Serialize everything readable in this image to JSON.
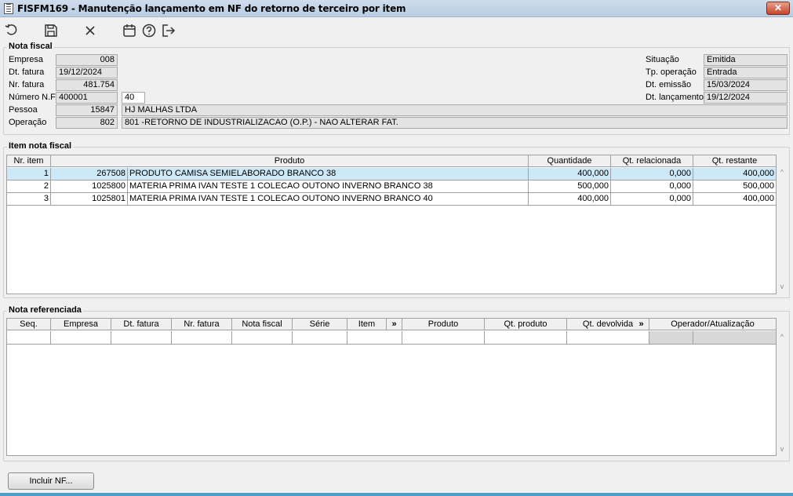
{
  "window": {
    "title": "FISFM169 - Manutenção lançamento em NF do retorno de terceiro por item",
    "close_glyph": "✕"
  },
  "toolbar": {
    "icons": [
      "undo-icon",
      "save-icon",
      "cancel-icon",
      "calendar-icon",
      "help-icon",
      "exit-icon"
    ]
  },
  "nota_fiscal": {
    "legend": "Nota fiscal",
    "empresa_label": "Empresa",
    "empresa": "008",
    "dt_fatura_label": "Dt. fatura",
    "dt_fatura": "19/12/2024",
    "nr_fatura_label": "Nr. fatura",
    "nr_fatura": "481.754",
    "numero_nf_label": "Número N.F",
    "numero_nf": "400001",
    "serie": "40",
    "pessoa_label": "Pessoa",
    "pessoa_code": "15847",
    "pessoa_name": "HJ MALHAS LTDA",
    "operacao_label": "Operação",
    "operacao_code": "802",
    "operacao_desc": "801 -RETORNO DE INDUSTRIALIZACAO (O.P.) - NAO ALTERAR FAT.",
    "situacao_label": "Situação",
    "situacao": "Emitida",
    "tp_operacao_label": "Tp. operação",
    "tp_operacao": "Entrada",
    "dt_emissao_label": "Dt. emissão",
    "dt_emissao": "15/03/2024",
    "dt_lancamento_label": "Dt. lançamento",
    "dt_lancamento": "19/12/2024"
  },
  "item_nota_fiscal": {
    "legend": "Item nota fiscal",
    "columns": [
      "Nr. item",
      "Produto",
      "Quantidade",
      "Qt. relacionada",
      "Qt. restante"
    ],
    "rows": [
      {
        "nr": "1",
        "cod": "267508",
        "produto": "PRODUTO CAMISA SEMIELABORADO BRANCO 38",
        "qtd": "400,000",
        "rel": "0,000",
        "rest": "400,000"
      },
      {
        "nr": "2",
        "cod": "1025800",
        "produto": "MATERIA PRIMA IVAN TESTE 1 COLECAO OUTONO INVERNO BRANCO 38",
        "qtd": "500,000",
        "rel": "0,000",
        "rest": "500,000"
      },
      {
        "nr": "3",
        "cod": "1025801",
        "produto": "MATERIA PRIMA IVAN TESTE 1 COLECAO OUTONO INVERNO BRANCO 40",
        "qtd": "400,000",
        "rel": "0,000",
        "rest": "400,000"
      }
    ]
  },
  "nota_referenciada": {
    "legend": "Nota referenciada",
    "columns": [
      "Seq.",
      "Empresa",
      "Dt. fatura",
      "Nr. fatura",
      "Nota fiscal",
      "Série",
      "Item",
      "»",
      "Produto",
      "Qt. produto",
      "Qt. devolvida",
      "»",
      "Operador/Atualização"
    ]
  },
  "footer": {
    "incluir_nf_label": "Incluir NF..."
  }
}
